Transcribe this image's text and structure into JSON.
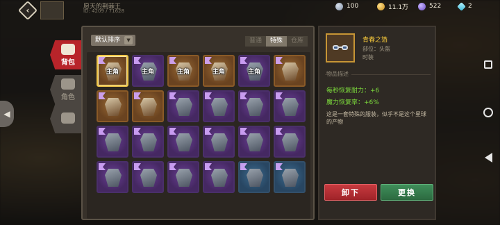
{
  "header": {
    "back_glyph": "‹",
    "player_name": "愿天的荆棘王",
    "player_id": "ID: 4209 / 71628"
  },
  "currencies": [
    {
      "icon": "silver-coin-icon",
      "value": "100"
    },
    {
      "icon": "gold-coin-icon",
      "value": "11.1万"
    },
    {
      "icon": "purple-gem-icon",
      "value": "522"
    },
    {
      "icon": "diamond-icon",
      "value": "2"
    }
  ],
  "left_tabs": [
    {
      "label": "背包",
      "icon": "backpack-icon",
      "active": true
    },
    {
      "label": "角色",
      "icon": "character-icon",
      "active": false
    },
    {
      "label": "",
      "icon": "gear-icon",
      "active": false
    }
  ],
  "toolbar": {
    "sort_label": "默认排序",
    "filters": [
      "普通",
      "特殊",
      "仓库"
    ],
    "active_filter": "特殊"
  },
  "equipped_tag": "主角",
  "inventory": [
    {
      "rarity": "orange",
      "equipped": true,
      "selected": true,
      "icon": "goggles-icon"
    },
    {
      "rarity": "purple",
      "equipped": true,
      "icon": "cape-icon"
    },
    {
      "rarity": "orange",
      "equipped": true,
      "icon": "helmet-icon"
    },
    {
      "rarity": "orange",
      "equipped": true,
      "icon": "mask-icon"
    },
    {
      "rarity": "purple",
      "equipped": true,
      "icon": "armor-icon"
    },
    {
      "rarity": "orange",
      "equipped": false,
      "icon": "gauntlet-icon"
    },
    {
      "rarity": "orange",
      "equipped": false,
      "icon": "demon-mask-icon"
    },
    {
      "rarity": "orange",
      "equipped": false,
      "icon": "snail-shell-icon"
    },
    {
      "rarity": "purple",
      "equipped": false,
      "icon": "horned-helmet-icon"
    },
    {
      "rarity": "purple",
      "equipped": false,
      "icon": "feather-helm-icon"
    },
    {
      "rarity": "purple",
      "equipped": false,
      "icon": "red-cloak-icon"
    },
    {
      "rarity": "purple",
      "equipped": false,
      "icon": "knight-helm-icon"
    },
    {
      "rarity": "purple",
      "equipped": false,
      "icon": "steel-helm-icon"
    },
    {
      "rarity": "purple",
      "equipped": false,
      "icon": "pauldron-icon"
    },
    {
      "rarity": "purple",
      "equipped": false,
      "icon": "gold-helm-icon"
    },
    {
      "rarity": "purple",
      "equipped": false,
      "icon": "leather-vest-icon"
    },
    {
      "rarity": "purple",
      "equipped": false,
      "icon": "boots-icon"
    },
    {
      "rarity": "purple",
      "equipped": false,
      "icon": "leg-guard-icon"
    },
    {
      "rarity": "purple",
      "equipped": false,
      "icon": "skull-mask-icon"
    },
    {
      "rarity": "purple",
      "equipped": false,
      "icon": "plate-armor-icon"
    },
    {
      "rarity": "purple",
      "equipped": false,
      "icon": "ring-icon"
    },
    {
      "rarity": "purple",
      "equipped": false,
      "icon": "bracer-icon"
    },
    {
      "rarity": "blue",
      "equipped": false,
      "icon": "chainmail-icon"
    },
    {
      "rarity": "blue",
      "equipped": false,
      "icon": "fish-skull-icon"
    }
  ],
  "detail": {
    "name": "青春之箔",
    "slot_label": "部位：头盔",
    "type_label": "时装",
    "section_title": "物品描述",
    "attr1": "每秒恢复耐力：+6",
    "attr2": "魔力恢复率：+6%",
    "description": "这是一套特殊的服装，似乎不是这个星球的产物",
    "unequip_label": "卸下",
    "change_label": "更换"
  },
  "colors": {
    "rarity_orange": "#9a6a35",
    "rarity_purple": "#6a3f94",
    "rarity_blue": "#3c6a8e",
    "unequip": "#b8242a",
    "change": "#3f8e5a",
    "attr": "#7ddc3c",
    "title": "#ffcf3b"
  }
}
